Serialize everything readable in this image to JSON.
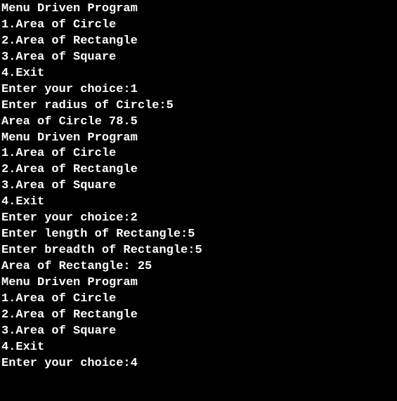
{
  "lines": [
    "Menu Driven Program",
    "1.Area of Circle",
    "2.Area of Rectangle",
    "3.Area of Square",
    "4.Exit",
    "Enter your choice:1",
    "Enter radius of Circle:5",
    "Area of Circle 78.5",
    "Menu Driven Program",
    "1.Area of Circle",
    "2.Area of Rectangle",
    "3.Area of Square",
    "4.Exit",
    "Enter your choice:2",
    "Enter length of Rectangle:5",
    "Enter breadth of Rectangle:5",
    "Area of Rectangle: 25",
    "Menu Driven Program",
    "1.Area of Circle",
    "2.Area of Rectangle",
    "3.Area of Square",
    "4.Exit",
    "Enter your choice:4"
  ]
}
